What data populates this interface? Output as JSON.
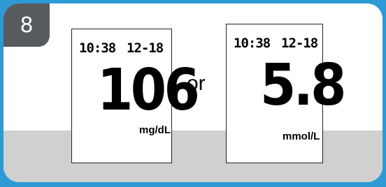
{
  "step": {
    "number": "8"
  },
  "left_display": {
    "time": "10:38",
    "date": "12-18",
    "reading": "106",
    "unit": "mg/dL"
  },
  "separator": {
    "text": "or"
  },
  "right_display": {
    "time": "10:38",
    "date": "12-18",
    "reading": "5.8",
    "unit": "mmol/L"
  },
  "colors": {
    "background": "#2d9ad6",
    "badge": "#575b5e",
    "card_bottom": "#d0d0d0"
  }
}
